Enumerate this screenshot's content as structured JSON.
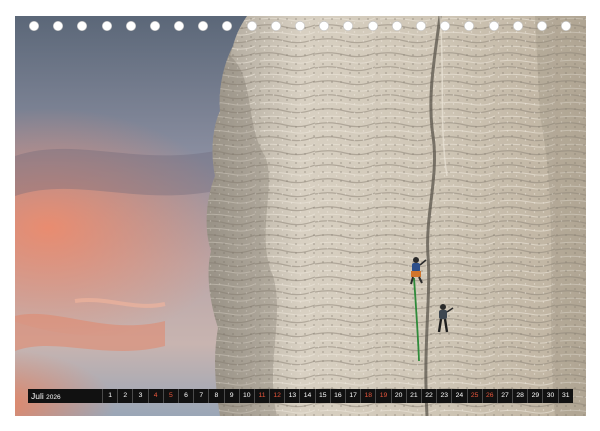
{
  "calendar": {
    "month_label": "Juli",
    "year_label": "2026",
    "days": [
      {
        "n": "1",
        "weekend": false
      },
      {
        "n": "2",
        "weekend": false
      },
      {
        "n": "3",
        "weekend": false
      },
      {
        "n": "4",
        "weekend": true
      },
      {
        "n": "5",
        "weekend": true
      },
      {
        "n": "6",
        "weekend": false
      },
      {
        "n": "7",
        "weekend": false
      },
      {
        "n": "8",
        "weekend": false
      },
      {
        "n": "9",
        "weekend": false
      },
      {
        "n": "10",
        "weekend": false
      },
      {
        "n": "11",
        "weekend": true
      },
      {
        "n": "12",
        "weekend": true
      },
      {
        "n": "13",
        "weekend": false
      },
      {
        "n": "14",
        "weekend": false
      },
      {
        "n": "15",
        "weekend": false
      },
      {
        "n": "16",
        "weekend": false
      },
      {
        "n": "17",
        "weekend": false
      },
      {
        "n": "18",
        "weekend": true
      },
      {
        "n": "19",
        "weekend": true
      },
      {
        "n": "20",
        "weekend": false
      },
      {
        "n": "21",
        "weekend": false
      },
      {
        "n": "22",
        "weekend": false
      },
      {
        "n": "23",
        "weekend": false
      },
      {
        "n": "24",
        "weekend": false
      },
      {
        "n": "25",
        "weekend": true
      },
      {
        "n": "26",
        "weekend": true
      },
      {
        "n": "27",
        "weekend": false
      },
      {
        "n": "28",
        "weekend": false
      },
      {
        "n": "29",
        "weekend": false
      },
      {
        "n": "30",
        "weekend": false
      },
      {
        "n": "31",
        "weekend": false
      }
    ]
  },
  "colors": {
    "weekend_day": "#e8563c",
    "strip_background": "#111111",
    "sky_top": "#5f6b7a",
    "sunset_glow": "#e98a6c",
    "rock": "#cfc6b6"
  }
}
